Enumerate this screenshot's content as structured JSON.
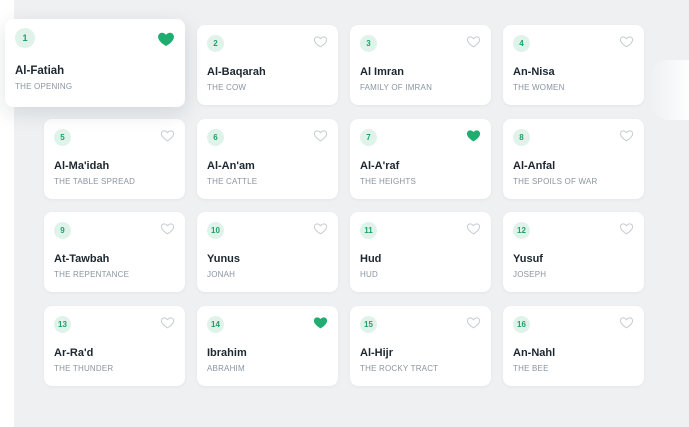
{
  "colors": {
    "accent": "#1fae70",
    "badge_bg": "#dff3ea",
    "heart_off": "#c6ccd2",
    "background": "#eef0f2"
  },
  "surahs": [
    {
      "number": "1",
      "name": "Al-Fatiah",
      "meaning": "THE OPENING",
      "favorite": true,
      "icon": "heart-icon"
    },
    {
      "number": "2",
      "name": "Al-Baqarah",
      "meaning": "THE COW",
      "favorite": false,
      "icon": "heart-outline-icon"
    },
    {
      "number": "3",
      "name": "Al Imran",
      "meaning": "FAMILY OF IMRAN",
      "favorite": false,
      "icon": "heart-outline-icon"
    },
    {
      "number": "4",
      "name": "An-Nisa",
      "meaning": "THE WOMEN",
      "favorite": false,
      "icon": "heart-outline-icon"
    },
    {
      "number": "5",
      "name": "Al-Ma'idah",
      "meaning": "THE TABLE SPREAD",
      "favorite": false,
      "icon": "heart-outline-icon"
    },
    {
      "number": "6",
      "name": "Al-An'am",
      "meaning": "THE CATTLE",
      "favorite": false,
      "icon": "heart-outline-icon"
    },
    {
      "number": "7",
      "name": "Al-A'raf",
      "meaning": "THE HEIGHTS",
      "favorite": true,
      "icon": "heart-icon"
    },
    {
      "number": "8",
      "name": "Al-Anfal",
      "meaning": "THE SPOILS OF WAR",
      "favorite": false,
      "icon": "heart-outline-icon"
    },
    {
      "number": "9",
      "name": "At-Tawbah",
      "meaning": "THE REPENTANCE",
      "favorite": false,
      "icon": "heart-outline-icon"
    },
    {
      "number": "10",
      "name": "Yunus",
      "meaning": "JONAH",
      "favorite": false,
      "icon": "heart-outline-icon"
    },
    {
      "number": "11",
      "name": "Hud",
      "meaning": "HUD",
      "favorite": false,
      "icon": "heart-outline-icon"
    },
    {
      "number": "12",
      "name": "Yusuf",
      "meaning": "JOSEPH",
      "favorite": false,
      "icon": "heart-outline-icon"
    },
    {
      "number": "13",
      "name": "Ar-Ra'd",
      "meaning": "THE THUNDER",
      "favorite": false,
      "icon": "heart-outline-icon"
    },
    {
      "number": "14",
      "name": "Ibrahim",
      "meaning": "ABRAHIM",
      "favorite": true,
      "icon": "heart-icon"
    },
    {
      "number": "15",
      "name": "Al-Hijr",
      "meaning": "THE ROCKY TRACT",
      "favorite": false,
      "icon": "heart-outline-icon"
    },
    {
      "number": "16",
      "name": "An-Nahl",
      "meaning": "THE BEE",
      "favorite": false,
      "icon": "heart-outline-icon"
    }
  ]
}
